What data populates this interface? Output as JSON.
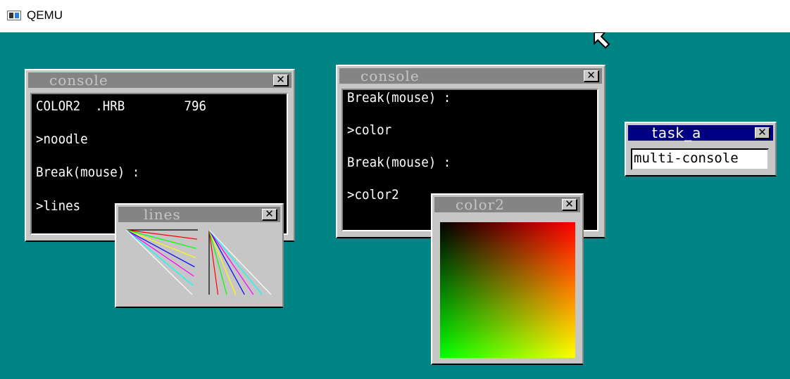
{
  "host": {
    "title": "QEMU",
    "icon": "qemu-app-icon"
  },
  "desktop": {
    "background": "#008484"
  },
  "windows": {
    "console1": {
      "title": "console",
      "close_label": "✕",
      "lines": [
        "COLOR2  .HRB        796",
        ">noodle",
        "Break(mouse) :",
        ">lines"
      ]
    },
    "console2": {
      "title": "console",
      "close_label": "✕",
      "lines": [
        "Break(mouse) :",
        ">color",
        "Break(mouse) :",
        ">color2"
      ]
    },
    "lines": {
      "title": "lines",
      "close_label": "✕"
    },
    "color2": {
      "title": "color2",
      "close_label": "✕"
    },
    "task_a": {
      "title": "task_a",
      "close_label": "✕",
      "field_value": "multi-console"
    }
  },
  "colors": {
    "window_face": "#c6c6c6",
    "inactive_titlebar": "#848484",
    "active_titlebar": "#000084",
    "line_palette": [
      "#000000",
      "#ff0000",
      "#00ff00",
      "#ffff00",
      "#0000ff",
      "#ff00ff",
      "#00ffff",
      "#ffffff"
    ]
  }
}
